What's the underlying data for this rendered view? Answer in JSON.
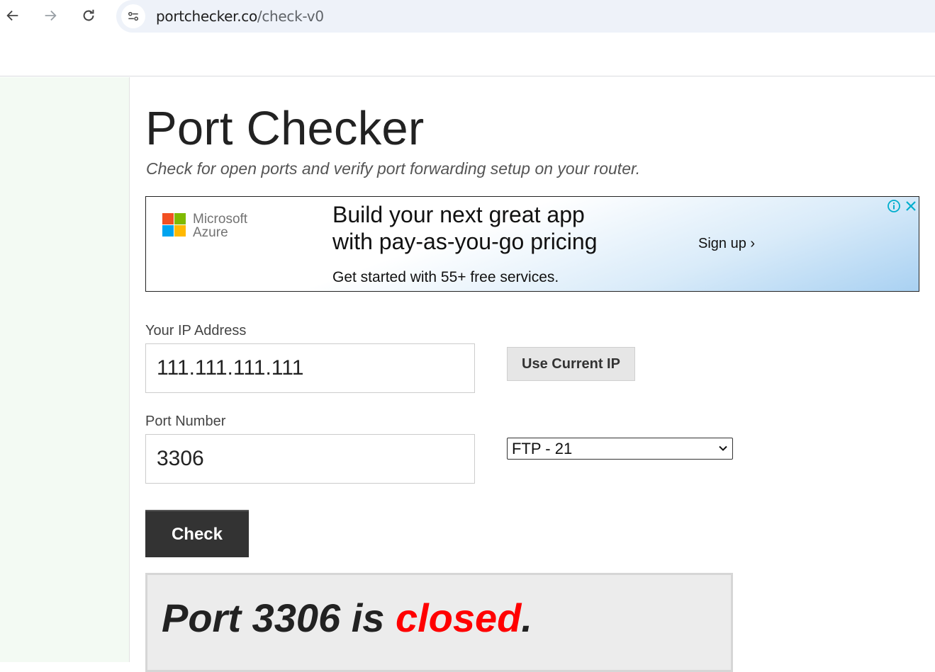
{
  "browser": {
    "url_host": "portchecker.co",
    "url_path": "/check-v0"
  },
  "page": {
    "title": "Port Checker",
    "subtitle": "Check for open ports and verify port forwarding setup on your router."
  },
  "ad": {
    "brand_line1": "Microsoft",
    "brand_line2": "Azure",
    "headline_line1": "Build your next great app",
    "headline_line2": "with pay-as-you-go pricing",
    "subtext": "Get started with 55+ free services.",
    "cta": "Sign up ›",
    "logo_colors": [
      "#f25022",
      "#7fba00",
      "#00a4ef",
      "#ffb900"
    ]
  },
  "form": {
    "ip_label": "Your IP Address",
    "ip_value": "111.111.111.111",
    "use_current_ip_label": "Use Current IP",
    "port_label": "Port Number",
    "port_value": "3306",
    "port_preset_selected": "FTP - 21",
    "check_label": "Check"
  },
  "result": {
    "prefix": "Port 3306 is ",
    "status": "closed",
    "suffix": ".",
    "status_color": "#ff0000"
  }
}
